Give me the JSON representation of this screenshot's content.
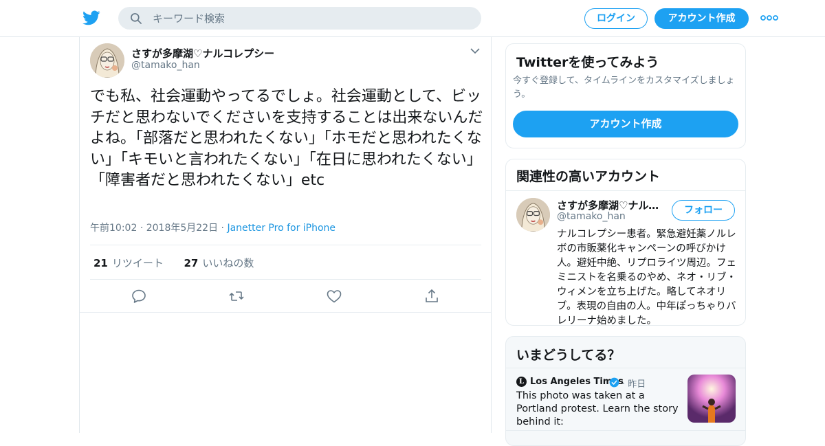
{
  "colors": {
    "brand": "#1da1f2",
    "text": "#14171a",
    "muted": "#657786",
    "link": "#1b95e0"
  },
  "header": {
    "search": {
      "placeholder": "キーワード検索"
    },
    "login_label": "ログイン",
    "signup_label": "アカウント作成"
  },
  "tweet": {
    "author_name": "さすが多摩湖♡ナルコレプシー",
    "author_handle": "@tamako_han",
    "text": "でも私、社会運動やってるでしょ。社会運動として、ビッチだと思わないでくださいを支持することは出来ないんだよね。「部落だと思われたくない」「ホモだと思われたくない」「キモいと言われたくない」「在日に思われたくない」「障害者だと思われたくない」etc",
    "time": "午前10:02",
    "date": "2018年5月22日",
    "source": "Janetter Pro for iPhone",
    "sep": "·",
    "retweet_count": "21",
    "retweet_label": "リツイート",
    "like_count": "27",
    "like_label": "いいねの数"
  },
  "signup_card": {
    "title": "Twitterを使ってみよう",
    "description": "今すぐ登録して、タイムラインをカスタマイズしましょう。",
    "button": "アカウント作成"
  },
  "related_card": {
    "title": "関連性の高いアカウント",
    "account": {
      "name": "さすが多摩湖♡ナルコレプシー",
      "handle": "@tamako_han",
      "follow_label": "フォロー",
      "bio": "ナルコレプシー患者。緊急避妊薬ノルレボの市販薬化キャンペーンの呼びかけ人。避妊中絶、リプロライツ周辺。フェミニストを名乗るのやめ、ネオ・リブ・ウィメンを立ち上げた。略してネオリブ。表現の自由の人。中年ぽっちゃりバレリーナ始めました。"
    }
  },
  "trends_card": {
    "title": "いまどうしてる？",
    "item": {
      "logo_letter": "L",
      "source": "Los Angeles Times",
      "time": "昨日",
      "text": "This photo was taken at a Portland protest. Learn the story behind it:"
    }
  }
}
